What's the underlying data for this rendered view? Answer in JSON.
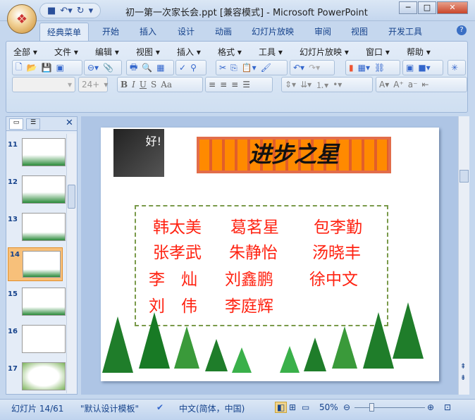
{
  "window": {
    "title": "初一第一次家长会.ppt [兼容模式] - Microsoft PowerPoint"
  },
  "tabs": [
    "经典菜单",
    "开始",
    "插入",
    "设计",
    "动画",
    "幻灯片放映",
    "审阅",
    "视图",
    "开发工具"
  ],
  "menus": [
    "全部",
    "文件",
    "编辑",
    "视图",
    "插入",
    "格式",
    "工具",
    "幻灯片放映",
    "窗口",
    "帮助"
  ],
  "format": {
    "font_size_placeholder": "24+"
  },
  "thumbnails": [
    "11",
    "12",
    "13",
    "14",
    "15",
    "16",
    "17"
  ],
  "selected_slide": "14",
  "slide": {
    "title": "进步之星",
    "badge": "好!",
    "names": [
      [
        "韩太美",
        "葛茗星",
        "包李勤"
      ],
      [
        "张孝武",
        "朱静怡",
        "汤晓丰"
      ],
      [
        "李　灿",
        "刘鑫鹏",
        "徐中文"
      ],
      [
        "刘　伟",
        "李庭辉",
        ""
      ]
    ]
  },
  "status": {
    "slide_counter": "幻灯片 14/61",
    "theme": "\"默认设计模板\"",
    "language": "中文(简体，中国)",
    "zoom": "50%"
  },
  "zoom_level_percent": 50
}
